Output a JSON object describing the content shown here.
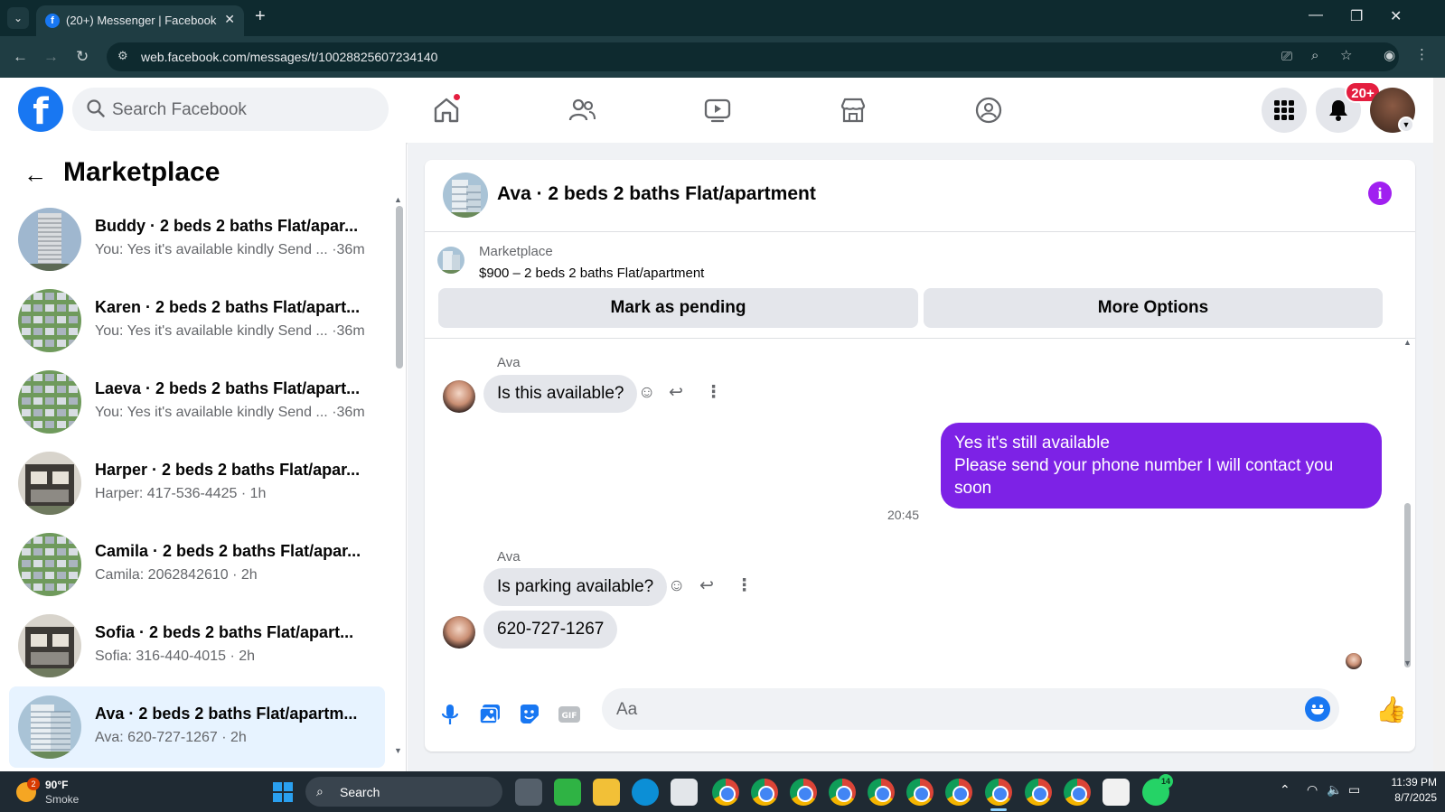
{
  "browser": {
    "tab_title": "(20+) Messenger | Facebook",
    "url": "web.facebook.com/messages/t/10028825607234140"
  },
  "facebook": {
    "search_placeholder": "Search Facebook",
    "notification_badge": "20+"
  },
  "sidebar": {
    "title": "Marketplace",
    "conversations": [
      {
        "name": "Buddy · 2 beds 2 baths Flat/apar...",
        "preview": "You: Yes it's available kindly Send ... ·36m",
        "thumb": "tower"
      },
      {
        "name": "Karen · 2 beds 2 baths Flat/apart...",
        "preview": "You: Yes it's available kindly Send ... ·36m",
        "thumb": "aerial"
      },
      {
        "name": "Laeva · 2 beds 2 baths Flat/apart...",
        "preview": "You: Yes it's available kindly Send ... ·36m",
        "thumb": "aerial"
      },
      {
        "name": "Harper · 2 beds 2 baths Flat/apar...",
        "preview": "Harper: 417-536-4425 · 1h",
        "thumb": "modern"
      },
      {
        "name": "Camila · 2 beds 2 baths Flat/apar...",
        "preview": "Camila: 2062842610 · 2h",
        "thumb": "aerial"
      },
      {
        "name": "Sofia · 2 beds 2 baths Flat/apart...",
        "preview": "Sofia: 316-440-4015 · 2h",
        "thumb": "modern"
      },
      {
        "name": "Ava · 2 beds 2 baths Flat/apartm...",
        "preview": "Ava: 620-727-1267 · 2h",
        "thumb": "glass",
        "active": true
      }
    ]
  },
  "chat": {
    "title": "Ava · 2 beds 2 baths Flat/apartment",
    "listing_source": "Marketplace",
    "listing_title": "$900 – 2 beds 2 baths Flat/apartment",
    "mark_pending_label": "Mark as pending",
    "more_options_label": "More Options",
    "sender_name": "Ava",
    "msg_in_1": "Is this available?",
    "msg_out_line1": "Yes it's still available",
    "msg_out_line2": "Please send your phone number I will contact you soon",
    "timestamp": "20:45",
    "sender_name_2": "Ava",
    "msg_in_2": "Is parking available?",
    "msg_in_3": "620-727-1267",
    "composer_placeholder": "Aa"
  },
  "taskbar": {
    "weather_badge": "2",
    "temperature": "90°F",
    "condition": "Smoke",
    "search_label": "Search",
    "whatsapp_badge": "14",
    "time": "11:39 PM",
    "date": "8/7/2025"
  },
  "colors": {
    "fb_blue": "#1877f2",
    "outgoing_bubble": "#7d22e6",
    "active_row": "#e7f3ff"
  }
}
